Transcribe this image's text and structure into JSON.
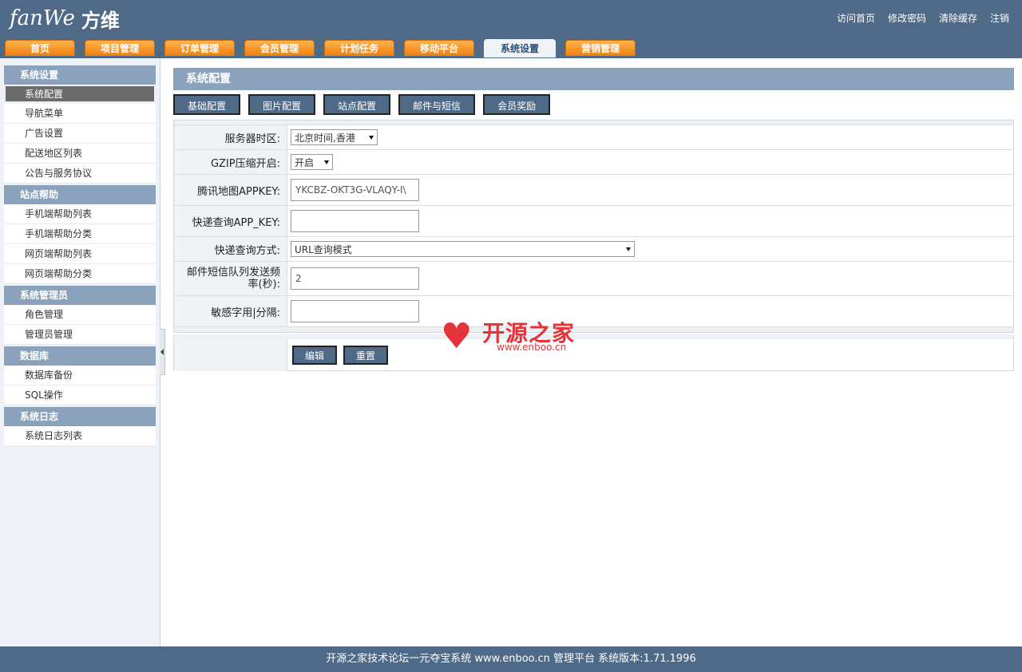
{
  "header": {
    "logo_brand": "fanWe",
    "logo_cn": "方维",
    "links": [
      "访问首页",
      "修改密码",
      "清除缓存",
      "注销"
    ]
  },
  "nav": {
    "tabs": [
      "首页",
      "项目管理",
      "订单管理",
      "会员管理",
      "计划任务",
      "移动平台",
      "系统设置",
      "营销管理"
    ],
    "active": "系统设置"
  },
  "sidebar": {
    "groups": [
      {
        "title": "系统设置",
        "items": [
          "系统配置",
          "导航菜单",
          "广告设置",
          "配送地区列表",
          "公告与服务协议"
        ]
      },
      {
        "title": "站点帮助",
        "items": [
          "手机端帮助列表",
          "手机端帮助分类",
          "网页端帮助列表",
          "网页端帮助分类"
        ]
      },
      {
        "title": "系统管理员",
        "items": [
          "角色管理",
          "管理员管理"
        ]
      },
      {
        "title": "数据库",
        "items": [
          "数据库备份",
          "SQL操作"
        ]
      },
      {
        "title": "系统日志",
        "items": [
          "系统日志列表"
        ]
      }
    ],
    "active_item": "系统配置"
  },
  "main": {
    "title": "系统配置",
    "subtabs": [
      "基础配置",
      "图片配置",
      "站点配置",
      "邮件与短信",
      "会员奖励"
    ],
    "form": {
      "timezone_label": "服务器时区:",
      "timezone_value": "北京时间,香港",
      "gzip_label": "GZIP压缩开启:",
      "gzip_value": "开启",
      "tencent_label": "腾讯地图APPKEY:",
      "tencent_value": "YKCBZ-OKT3G-VLAQY-I\\",
      "express_key_label": "快递查询APP_KEY:",
      "express_key_value": "",
      "express_mode_label": "快递查询方式:",
      "express_mode_value": "URL查询模式",
      "queue_label_1": "邮件短信队列发送频",
      "queue_label_2": "率(秒):",
      "queue_value": "2",
      "sensitive_label": "敏感字用|分隔:",
      "sensitive_value": ""
    },
    "buttons": {
      "edit": "编辑",
      "reset": "重置"
    }
  },
  "watermark": {
    "text": "开源之家",
    "url": "www.enboo.cn"
  },
  "footer": {
    "text": "开源之家技术论坛一元夺宝系统 www.enboo.cn 管理平台 系统版本:1.71.1996"
  }
}
